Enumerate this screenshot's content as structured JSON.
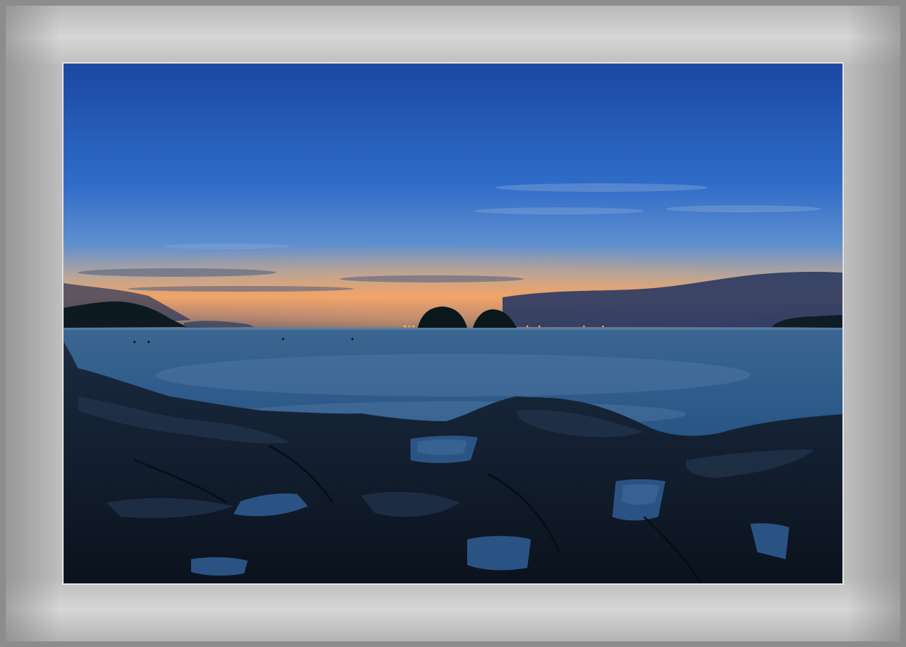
{
  "image": {
    "subject": "",
    "palette": {
      "sky_top": "#1e4fa8",
      "sky_mid": "#3d7cd0",
      "horizon_glow": "#f0a469",
      "sea": "#2b5785",
      "rocks": "#121c2c",
      "mat": "#bdbdbd"
    }
  }
}
